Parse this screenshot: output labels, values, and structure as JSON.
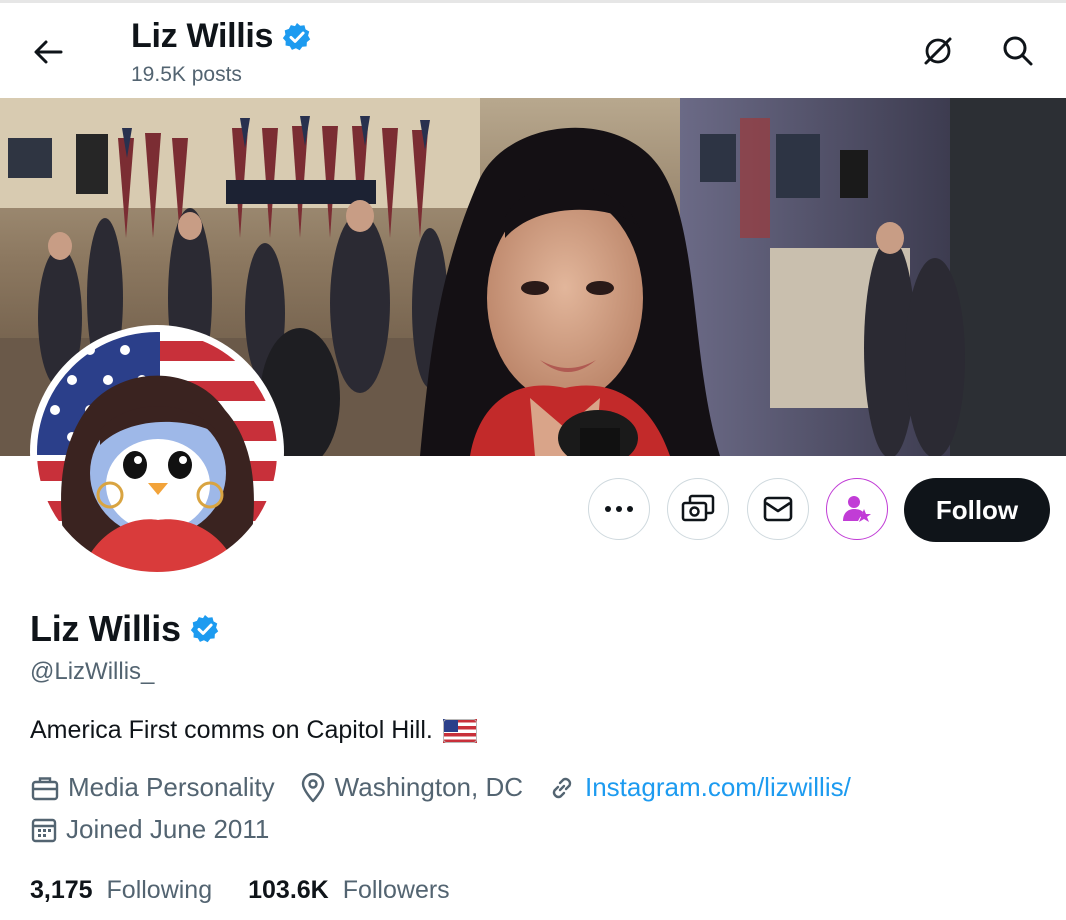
{
  "header": {
    "name": "Liz Willis",
    "posts": "19.5K posts"
  },
  "actions": {
    "more_icon": "more-dots-icon",
    "tip_icon": "money-icon",
    "message_icon": "mail-icon",
    "subscribe_icon": "person-star-icon",
    "follow_label": "Follow"
  },
  "profile": {
    "display_name": "Liz Willis",
    "handle": "@LizWillis_",
    "bio": "America First comms on Capitol Hill.",
    "bio_emoji": "us-flag-icon",
    "category": "Media Personality",
    "location": "Washington, DC",
    "website": "Instagram.com/lizwillis/",
    "joined": "Joined June 2011",
    "following_count": "3,175",
    "following_label": "Following",
    "followers_count": "103.6K",
    "followers_label": "Followers"
  },
  "colors": {
    "verified": "#1d9bf0",
    "link": "#1d9bf0",
    "subscribe_accent": "#c13cd6",
    "follow_button": "#0f1419"
  }
}
